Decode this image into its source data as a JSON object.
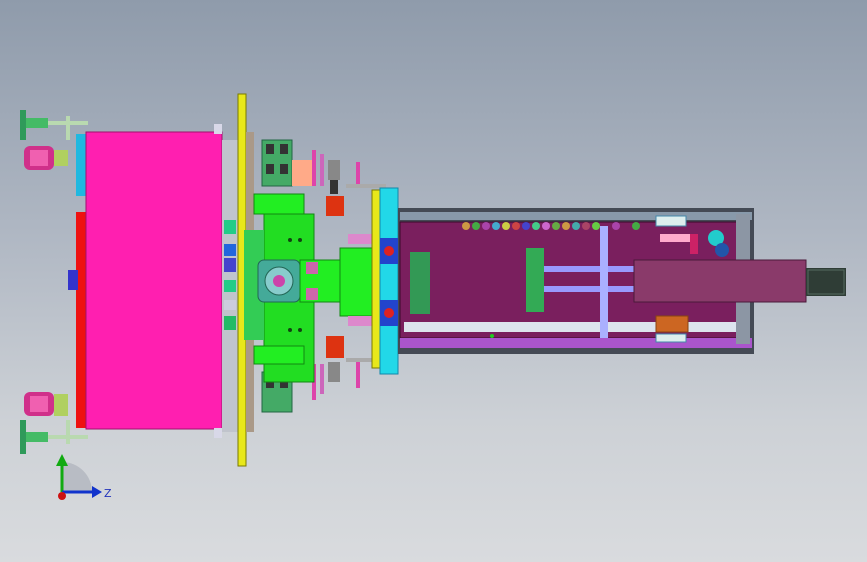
{
  "viewport": {
    "background_top": "#8f9bab",
    "background_bottom": "#d9dbde"
  },
  "triad": {
    "z_label": "Z",
    "x_color": "#cc1111",
    "y_color": "#11aa11",
    "z_color": "#1133cc"
  },
  "colors": {
    "housing": "#ff1fb0",
    "plate": "#e8e81a",
    "slide_bed": "#7a1f5e",
    "green_block": "#22ee22",
    "cyan_rail": "#22d8e8",
    "motor": "#8a3a6a"
  }
}
